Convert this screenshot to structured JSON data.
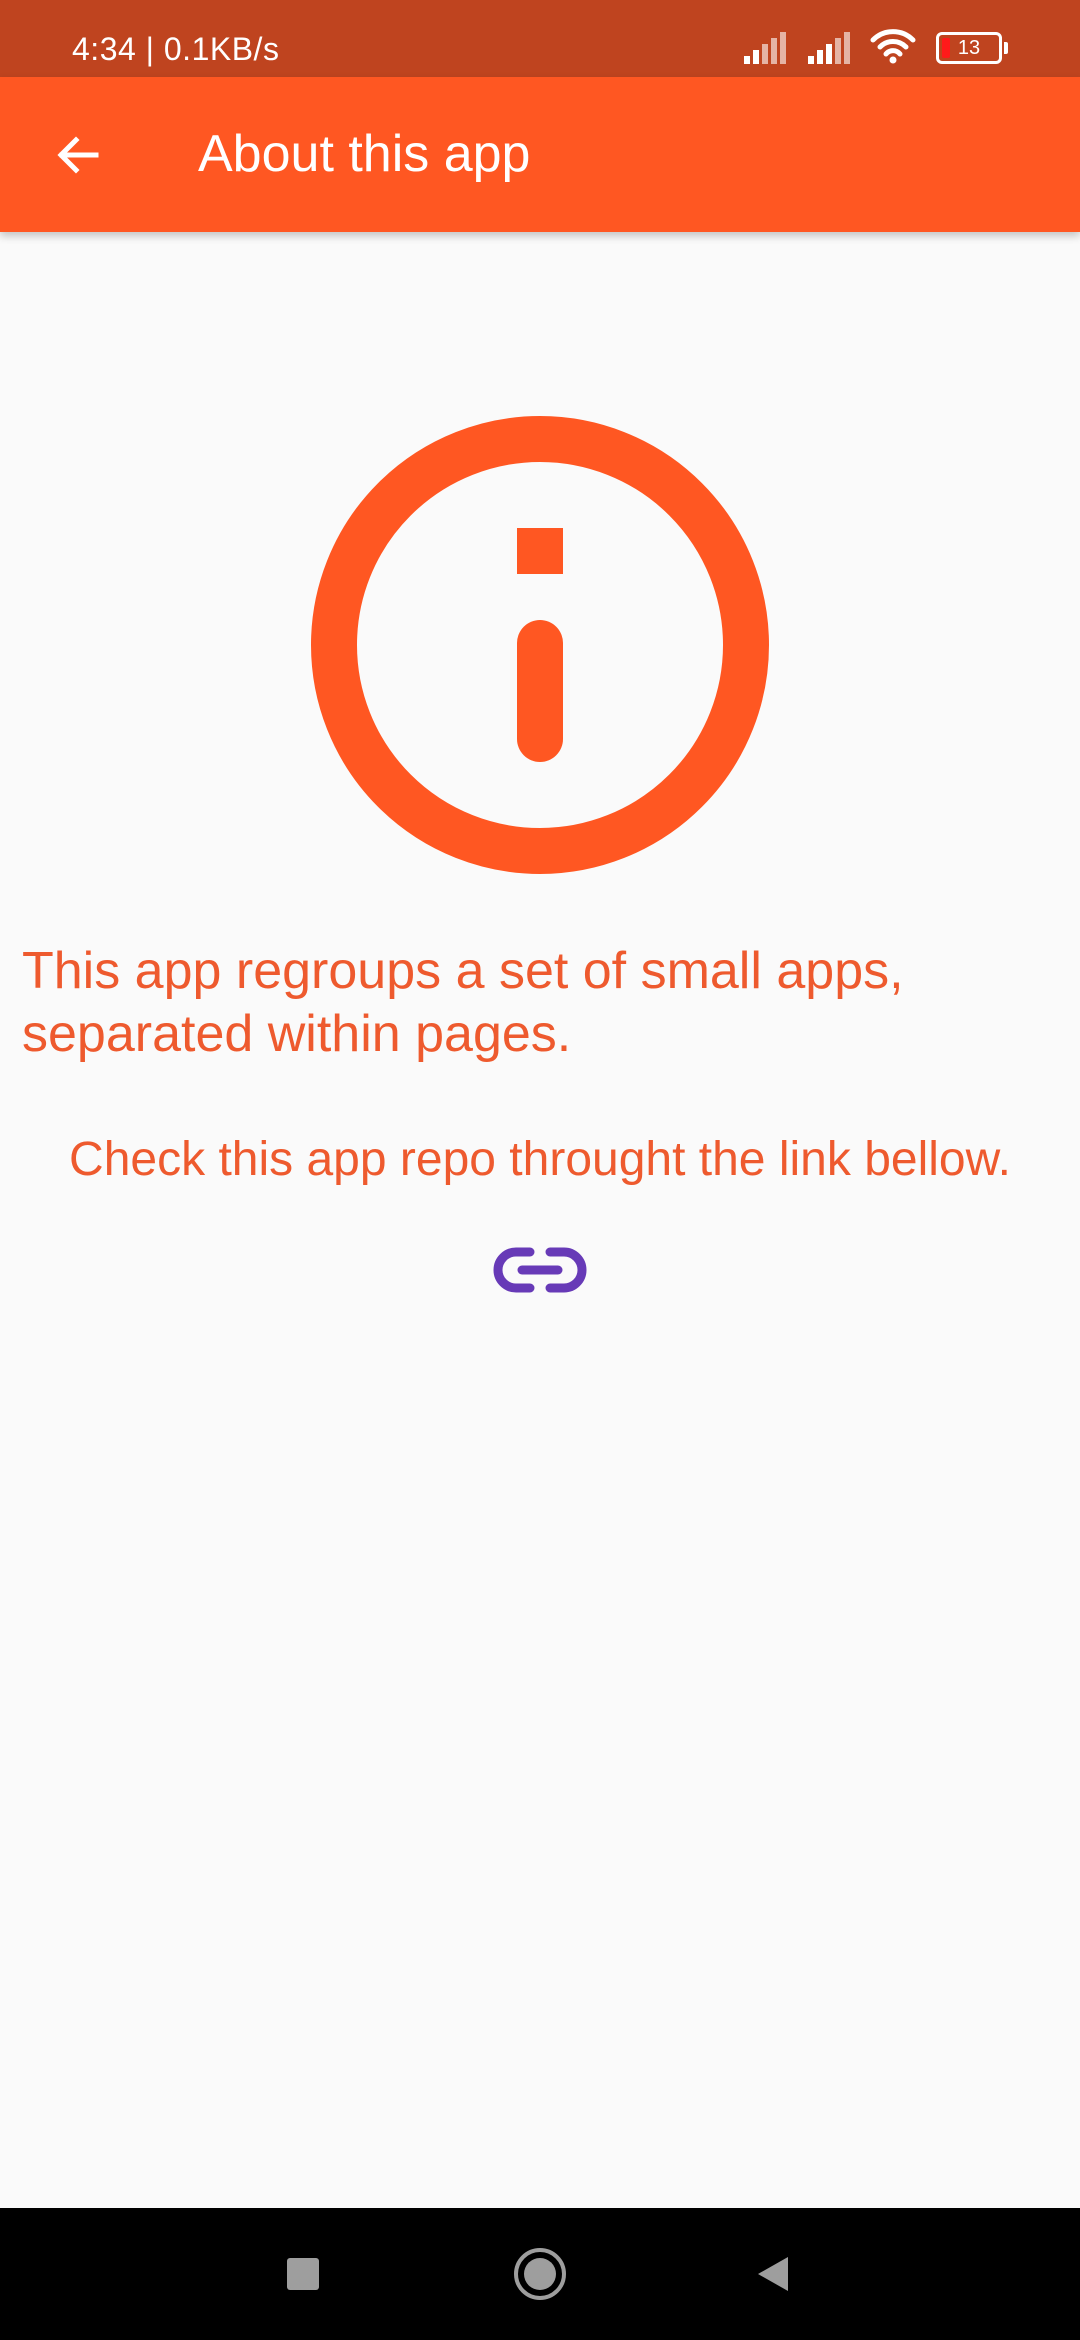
{
  "status_bar": {
    "time_speed": "4:34 | 0.1KB/s",
    "battery_level": "13",
    "icons": [
      "signal-icon",
      "signal-icon",
      "wifi-icon",
      "battery-icon"
    ]
  },
  "app_bar": {
    "title": "About this app",
    "back_icon": "arrow-back-icon"
  },
  "main": {
    "hero_icon": "info-icon",
    "description": "This app regroups a set of small apps, separated within pages.",
    "repo_note": "Check this app repo throught the link bellow.",
    "link_icon": "link-icon"
  },
  "navigation_bar": {
    "buttons": [
      "recents-icon",
      "home-icon",
      "back-icon"
    ]
  },
  "colors": {
    "status_bar": "#bf441f",
    "app_bar": "#ff5722",
    "accent_text": "#ee5a2e",
    "link": "#673ab7",
    "background": "#fafafa"
  }
}
